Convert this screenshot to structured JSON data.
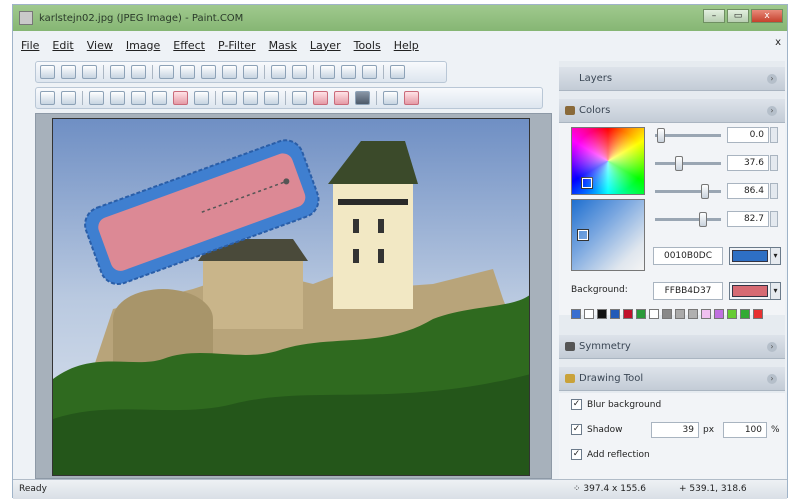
{
  "window": {
    "title": "karlstejn02.jpg (JPEG Image) - Paint.COM",
    "controls": {
      "minimize": "–",
      "maximize": "▭",
      "close": "x"
    }
  },
  "menu": {
    "items": [
      "File",
      "Edit",
      "View",
      "Image",
      "Effect",
      "P-Filter",
      "Mask",
      "Layer",
      "Tools",
      "Help"
    ],
    "close_glyph": "x"
  },
  "panels": {
    "layers": {
      "title": "Layers"
    },
    "colors": {
      "title": "Colors",
      "sliders": [
        "0.0",
        "37.6",
        "86.4",
        "82.7"
      ],
      "hex": "0010B0DC",
      "primary_color": "#2e6fc4",
      "background_label": "Background:",
      "background_hex": "FFBB4D37",
      "background_color": "#d66a73",
      "palette": [
        "#3a6fd0",
        "#ffffff",
        "#111111",
        "#225bb8",
        "#c0102a",
        "#2a9a3a",
        "#ffffff",
        "#888888",
        "#aaaaaa",
        "#b0b0b0",
        "#f0c0f0",
        "#c070e0",
        "#66cc33",
        "#33aa33",
        "#e83030"
      ]
    },
    "symmetry": {
      "title": "Symmetry"
    },
    "drawing_tool": {
      "title": "Drawing Tool",
      "blur_background": "Blur background",
      "shadow": "Shadow",
      "shadow_size": "39",
      "shadow_unit": "px",
      "shadow_opacity": "100",
      "shadow_opacity_unit": "%",
      "add_reflection": "Add reflection"
    }
  },
  "statusbar": {
    "state": "Ready",
    "selection": "⁘  397.4 x 155.6",
    "cursor": "+ 539.1, 318.6"
  },
  "colors": {
    "selection_fill": "#e98a8f",
    "selection_border": "#3f7fd0",
    "sky": "#9fb8d8",
    "foliage": "#2f6a1f"
  }
}
